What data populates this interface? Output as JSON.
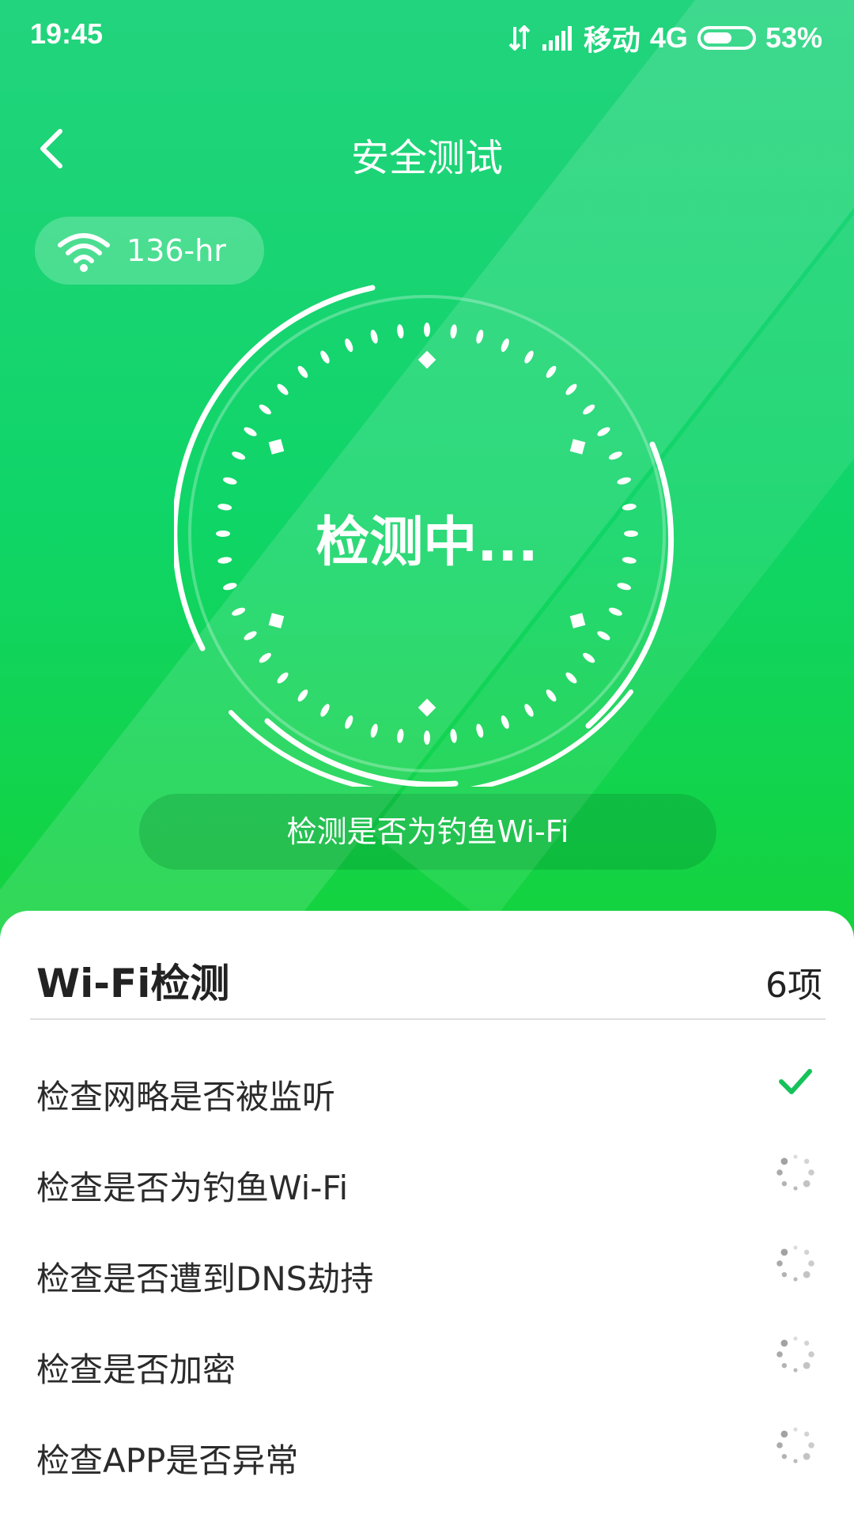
{
  "status_bar": {
    "time": "19:45",
    "carrier": "移动",
    "network": "4G",
    "battery": "53%",
    "battery_level": 0.53
  },
  "header": {
    "back_icon": "chevron-left-icon",
    "title": "安全测试"
  },
  "wifi": {
    "icon": "wifi-icon",
    "ssid": "136-hr"
  },
  "scan": {
    "status": "检测中...",
    "current_task": "检测是否为钓鱼Wi-Fi"
  },
  "checklist": {
    "title": "Wi-Fi检测",
    "count": "6项",
    "items": [
      {
        "label": "检查网略是否被监听",
        "state": "done",
        "icon": "checkmark-icon"
      },
      {
        "label": "检查是否为钓鱼Wi-Fi",
        "state": "loading",
        "icon": "spinner-icon"
      },
      {
        "label": "检查是否遭到DNS劫持",
        "state": "loading",
        "icon": "spinner-icon"
      },
      {
        "label": "检查是否加密",
        "state": "loading",
        "icon": "spinner-icon"
      },
      {
        "label": "检查APP是否异常",
        "state": "loading",
        "icon": "spinner-icon"
      }
    ]
  },
  "colors": {
    "accent": "#16c25a",
    "hero_top": "#22d47e",
    "hero_bottom": "#14d33c",
    "text_dark": "#222222",
    "spinner_gray": "#9a9a9a"
  }
}
